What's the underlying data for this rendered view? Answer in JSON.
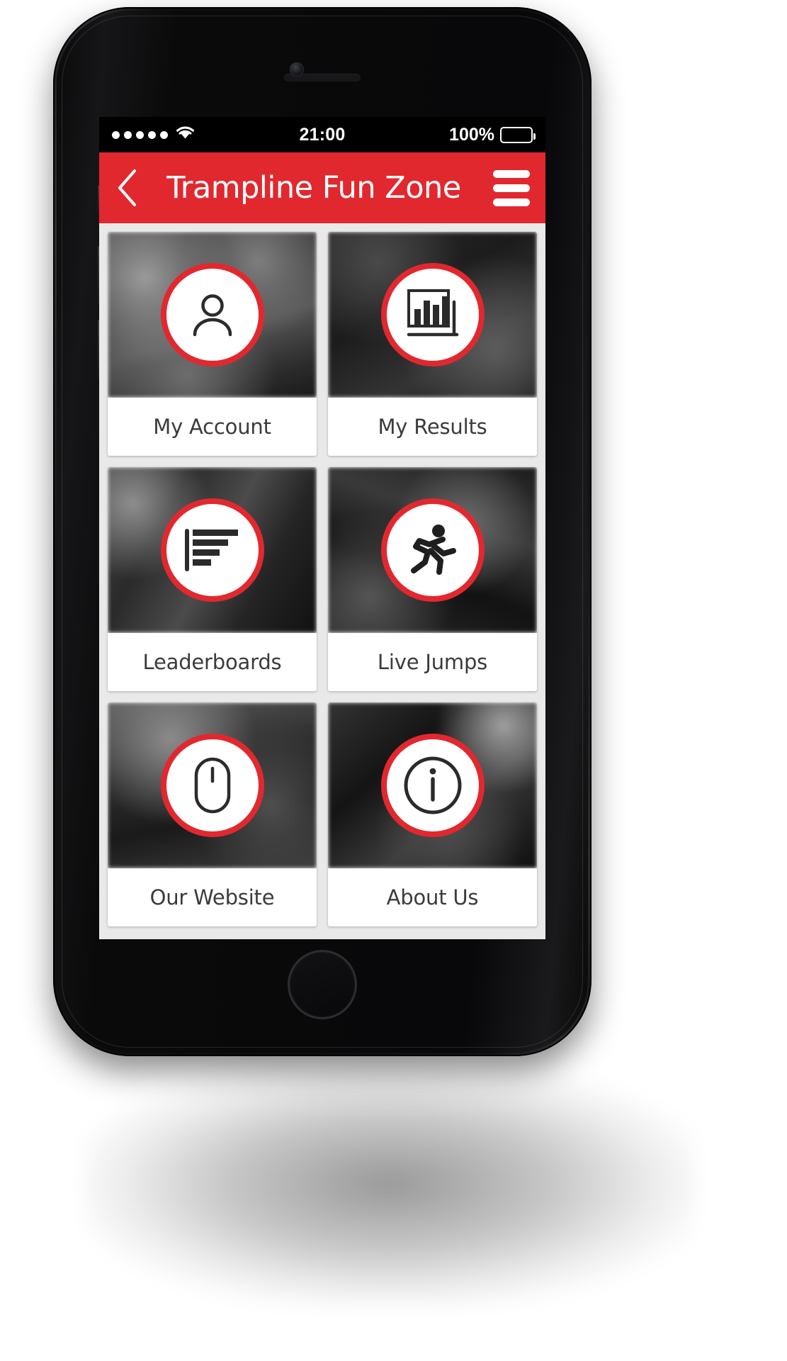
{
  "status_bar": {
    "signal_dots": 5,
    "wifi_icon": "wifi-icon",
    "time": "21:00",
    "battery_percent": "100%",
    "battery_level": 100
  },
  "header": {
    "back_icon": "back-chevron-icon",
    "title": "Trampline Fun Zone",
    "menu_icon": "hamburger-menu-icon",
    "background_color": "#e2282f"
  },
  "theme": {
    "accent": "#e2282f",
    "screen_background": "#e9e9e9",
    "tile_background": "#ffffff",
    "label_text_color": "#3b3b3b"
  },
  "grid": {
    "tiles": [
      {
        "label": "My Account",
        "icon": "user-person-icon",
        "bg": "bg-a"
      },
      {
        "label": "My Results",
        "icon": "bar-chart-icon",
        "bg": "bg-b"
      },
      {
        "label": "Leaderboards",
        "icon": "ranked-list-icon",
        "bg": "bg-c"
      },
      {
        "label": "Live Jumps",
        "icon": "running-person-icon",
        "bg": "bg-d"
      },
      {
        "label": "Our Website",
        "icon": "computer-mouse-icon",
        "bg": "bg-e"
      },
      {
        "label": "About Us",
        "icon": "info-circle-icon",
        "bg": "bg-f"
      }
    ]
  }
}
